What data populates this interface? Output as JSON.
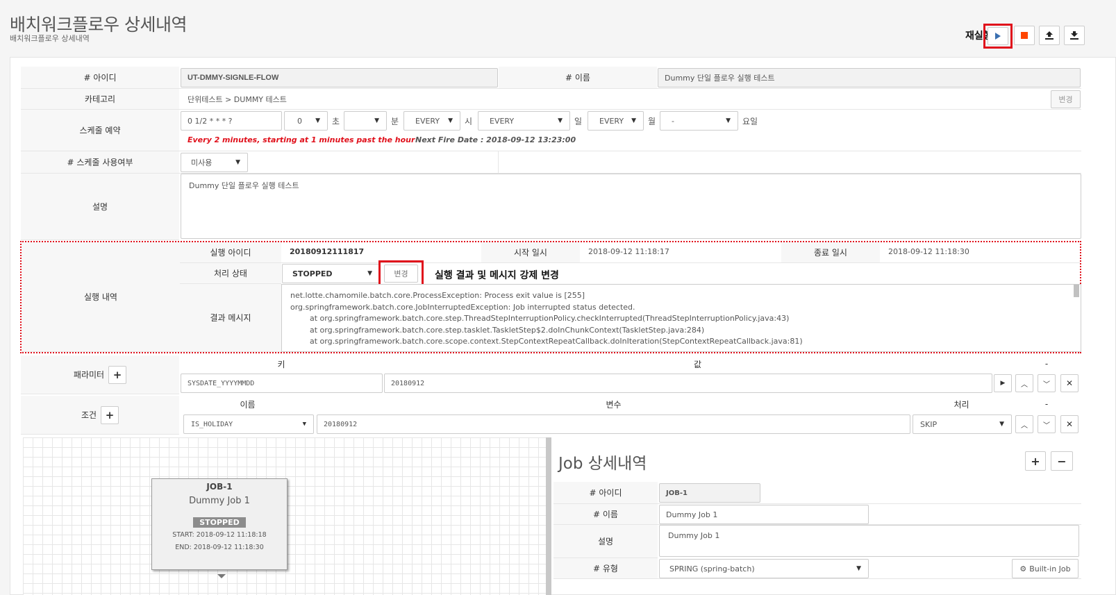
{
  "header": {
    "title": "배치워크플로우 상세내역",
    "subtitle": "배치워크플로우 상세내역",
    "rerun_label": "재실행"
  },
  "toolbar": {
    "play_icon": "play-icon",
    "stop_icon": "stop-icon",
    "upload_icon": "upload-icon",
    "download_icon": "download-icon"
  },
  "form": {
    "id_label": "# 아이디",
    "id_value": "UT-DMMY-SIGNLE-FLOW",
    "name_label": "# 이름",
    "name_value": "Dummy 단일 플로우 실행 테스트",
    "category_label": "카테고리",
    "category_value": "단위테스트 > DUMMY 테스트",
    "category_change": "변경",
    "schedule_label": "스케줄 예약",
    "cron": "0 1/2 * * * ?",
    "sec_value": "0",
    "sec_unit": "초",
    "min_value": "",
    "min_unit": "분",
    "hour_value": "EVERY",
    "hour_unit": "시",
    "day_value": "EVERY",
    "day_unit": "일",
    "month_value": "EVERY",
    "month_unit": "월",
    "weekday_value": "-",
    "weekday_unit": "요일",
    "cron_desc": "Every 2 minutes, starting at 1 minutes past the hour",
    "next_fire": "Next Fire Date : 2018-09-12 13:23:00",
    "schedule_use_label": "# 스케줄 사용여부",
    "schedule_use_value": "미사용",
    "desc_label": "설명",
    "desc_value": "Dummy 단일 플로우 실행 테스트"
  },
  "exec": {
    "section_label": "실행 내역",
    "exec_id_label": "실행 아이디",
    "exec_id_value": "20180912111817",
    "start_label": "시작 일시",
    "start_value": "2018-09-12 11:18:17",
    "end_label": "종료 일시",
    "end_value": "2018-09-12 11:18:30",
    "status_label": "처리 상태",
    "status_value": "STOPPED",
    "change_button": "변경",
    "annotation": "실행 결과 및 메시지 강제 변경",
    "msg_label": "결과 메시지",
    "message_lines": [
      "net.lotte.chamomile.batch.core.ProcessException: Process exit value is [255]",
      "org.springframework.batch.core.JobInterruptedException: Job interrupted status detected.",
      "        at org.springframework.batch.core.step.ThreadStepInterruptionPolicy.checkInterrupted(ThreadStepInterruptionPolicy.java:43)",
      "        at org.springframework.batch.core.step.tasklet.TaskletStep$2.doInChunkContext(TaskletStep.java:284)",
      "        at org.springframework.batch.core.scope.context.StepContextRepeatCallback.doInIteration(StepContextRepeatCallback.java:81)"
    ]
  },
  "params": {
    "label": "패라미터",
    "key_header": "키",
    "value_header": "값",
    "dash": "-",
    "key": "SYSDATE_YYYYMMDD",
    "value": "20180912"
  },
  "conditions": {
    "label": "조건",
    "name_header": "이름",
    "var_header": "변수",
    "proc_header": "처리",
    "dash": "-",
    "name": "IS_HOLIDAY",
    "var": "20180912",
    "proc": "SKIP"
  },
  "job_node": {
    "title": "JOB-1",
    "name": "Dummy Job 1",
    "status": "STOPPED",
    "start": "START: 2018-09-12 11:18:18",
    "end": "END: 2018-09-12 11:18:30"
  },
  "job_detail": {
    "title": "Job 상세내역",
    "id_label": "# 아이디",
    "id_value": "JOB-1",
    "name_label": "# 이름",
    "name_value": "Dummy Job 1",
    "desc_label": "설명",
    "desc_value": "Dummy Job 1",
    "type_label": "# 유형",
    "type_value": "SPRING (spring-batch)",
    "builtin_button": "Built-in Job"
  },
  "colors": {
    "red": "#e0101b",
    "status_gray": "#8c8c8c",
    "play_blue": "#3a6fb0",
    "stop_orange": "#ff4500"
  }
}
